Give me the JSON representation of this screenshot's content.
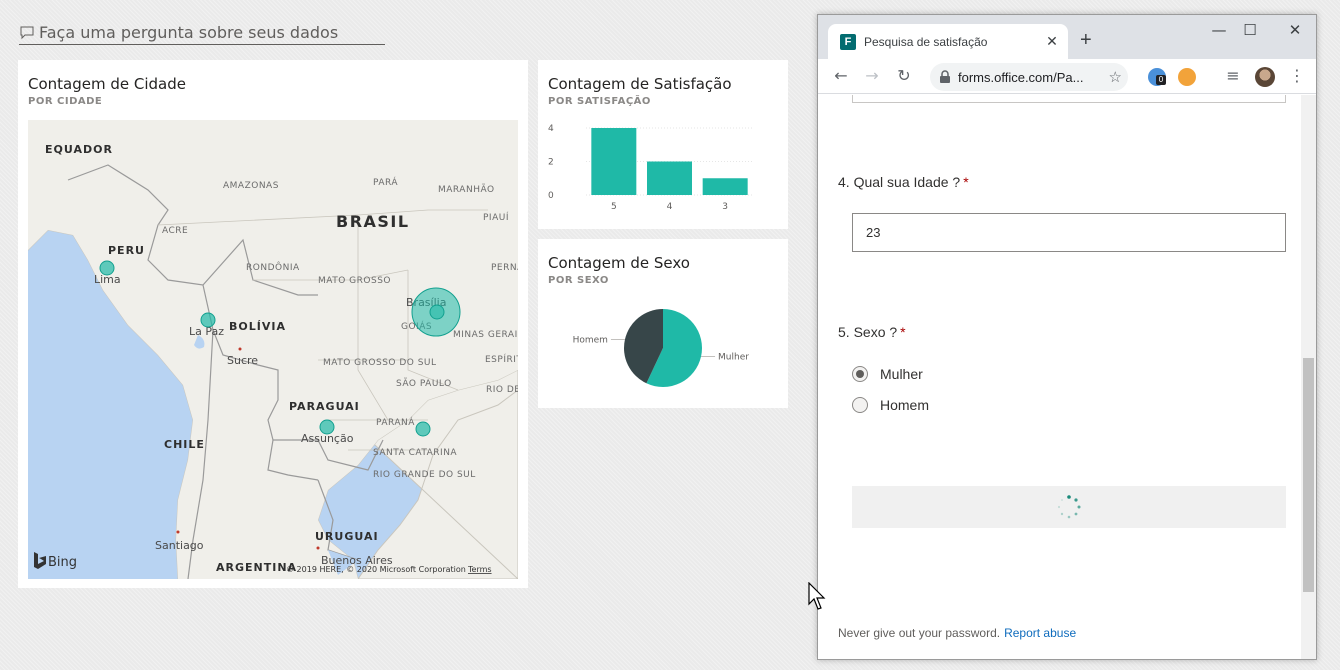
{
  "qna": {
    "placeholder": "Faça uma pergunta sobre seus dados"
  },
  "tiles": {
    "map": {
      "title": "Contagem de Cidade",
      "subtitle": "POR CIDADE"
    },
    "satisfaction": {
      "title": "Contagem de Satisfação",
      "subtitle": "POR SATISFAÇÃO"
    },
    "sex": {
      "title": "Contagem de Sexo",
      "subtitle": "POR SEXO"
    }
  },
  "map": {
    "countries": [
      "EQUADOR",
      "PERU",
      "BOLÍVIA",
      "PARAGUAI",
      "CHILE",
      "URUGUAI",
      "ARGENTINA"
    ],
    "country_main": "BRASIL",
    "regions": [
      "AMAZONAS",
      "PARÁ",
      "MARANHÃO",
      "PIAUÍ",
      "ACRE",
      "RONDÔNIA",
      "MATO GROSSO",
      "PERNAMBUCO",
      "GOIÁS",
      "MINAS GERAIS",
      "ESPÍRITO",
      "MATO GROSSO DO SUL",
      "SÃO PAULO",
      "RIO DE JANEIRO",
      "PARANÁ",
      "SANTA CATARINA",
      "RIO GRANDE DO SUL"
    ],
    "cities": [
      "Lima",
      "La Paz",
      "Sucre",
      "Brasília",
      "Assunção",
      "Santiago",
      "Buenos Aires"
    ],
    "bubble_color": "#1fb9a7",
    "logo": "Bing",
    "credit": "© 2019 HERE, © 2020 Microsoft Corporation",
    "terms": "Terms"
  },
  "chart_data": [
    {
      "type": "bar",
      "title": "Contagem de Satisfação",
      "subtitle": "POR SATISFAÇÃO",
      "categories": [
        "5",
        "4",
        "3"
      ],
      "values": [
        4,
        2,
        1
      ],
      "ylim": [
        0,
        4
      ],
      "yticks": [
        0,
        2,
        4
      ],
      "color": "#1fb9a7",
      "grid": true
    },
    {
      "type": "pie",
      "title": "Contagem de Sexo",
      "subtitle": "POR SEXO",
      "categories": [
        "Mulher",
        "Homem"
      ],
      "values": [
        0.57,
        0.43
      ],
      "colors": [
        "#1fb9a7",
        "#374649"
      ]
    }
  ],
  "browser": {
    "tab_title": "Pesquisa de satisfação",
    "url": "forms.office.com/Pa...",
    "ext_badge": "0"
  },
  "form": {
    "q4_label": "4. Qual sua Idade ?",
    "q4_value": "23",
    "q5_label": "5. Sexo ?",
    "required_mark": "*",
    "options": [
      "Mulher",
      "Homem"
    ],
    "selected_option": "Mulher",
    "footer_text": "Never give out your password.",
    "footer_link": "Report abuse"
  }
}
